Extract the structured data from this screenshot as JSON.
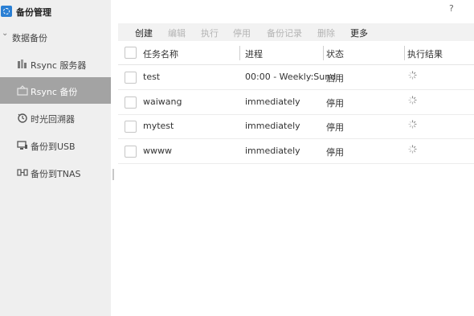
{
  "app": {
    "title": "备份管理",
    "icon": "backup-app-icon",
    "accent": "#2a7fd4"
  },
  "help_label": "?",
  "sidebar": {
    "section": {
      "label": "数据备份",
      "icon": "chevron-down-icon"
    },
    "items": [
      {
        "label": "Rsync 服务器",
        "icon": "server-icon",
        "active": false
      },
      {
        "label": "Rsync 备份",
        "icon": "sync-backup-icon",
        "active": true
      },
      {
        "label": "时光回溯器",
        "icon": "time-machine-icon",
        "active": false
      },
      {
        "label": "备份到USB",
        "icon": "usb-icon",
        "active": false
      },
      {
        "label": "备份到TNAS",
        "icon": "nas-icon",
        "active": false
      }
    ],
    "active_color": "#a3a3a3"
  },
  "toolbar": {
    "create": "创建",
    "edit": "编辑",
    "execute": "执行",
    "disable": "停用",
    "backup_log": "备份记录",
    "delete": "删除",
    "more": "更多"
  },
  "table": {
    "columns": {
      "name": "任务名称",
      "schedule": "进程",
      "status": "状态",
      "result": "执行结果"
    },
    "rows": [
      {
        "name": "test",
        "schedule": "00:00 - Weekly:Sund",
        "status": "启用",
        "result_icon": "loading-spinner-icon"
      },
      {
        "name": "waiwang",
        "schedule": "immediately",
        "status": "停用",
        "result_icon": "loading-spinner-icon"
      },
      {
        "name": "mytest",
        "schedule": "immediately",
        "status": "停用",
        "result_icon": "loading-spinner-icon"
      },
      {
        "name": "wwww",
        "schedule": "immediately",
        "status": "停用",
        "result_icon": "loading-spinner-icon"
      }
    ]
  }
}
